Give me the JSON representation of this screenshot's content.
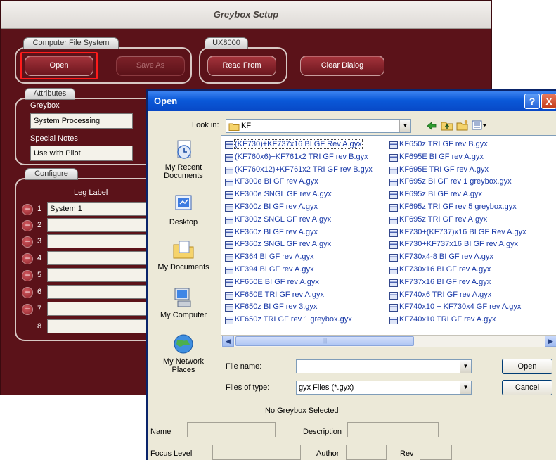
{
  "greybox": {
    "title": "Greybox Setup",
    "groups": {
      "computer_file_system": "Computer File System",
      "ux8000": "UX8000",
      "attributes": "Attributes",
      "configure": "Configure"
    },
    "buttons": {
      "open": "Open",
      "save_as": "Save As",
      "read_from": "Read From",
      "clear_dialog": "Clear Dialog"
    },
    "attributes": {
      "greybox_label": "Greybox",
      "greybox_value": "System Processing",
      "special_notes_label": "Special Notes",
      "special_notes_value": "Use with Pilot"
    },
    "configure": {
      "leg_label_header": "Leg Label",
      "rows": [
        {
          "num": "1",
          "value": "System 1"
        },
        {
          "num": "2",
          "value": ""
        },
        {
          "num": "3",
          "value": ""
        },
        {
          "num": "4",
          "value": ""
        },
        {
          "num": "5",
          "value": ""
        },
        {
          "num": "6",
          "value": ""
        },
        {
          "num": "7",
          "value": ""
        },
        {
          "num": "8",
          "value": ""
        }
      ]
    }
  },
  "open_dialog": {
    "title": "Open",
    "help_glyph": "?",
    "close_glyph": "X",
    "look_in_label": "Look in:",
    "look_in_value": "KF",
    "places": {
      "recent": "My Recent Documents",
      "desktop": "Desktop",
      "documents": "My Documents",
      "computer": "My Computer",
      "network": "My Network Places"
    },
    "files_col1": [
      "(KF730)+KF737x16 BI GF Rev A.gyx",
      "(KF760x6)+KF761x2 TRI GF rev B.gyx",
      "(KF760x12)+KF761x2 TRI GF rev B.gyx",
      "KF300e BI GF rev A.gyx",
      "KF300e SNGL GF rev A.gyx",
      "KF300z BI GF rev A.gyx",
      "KF300z SNGL GF rev A.gyx",
      "KF360z BI GF rev A.gyx",
      "KF360z SNGL GF rev A.gyx",
      "KF364 BI GF rev A.gyx",
      "KF394 BI GF rev A.gyx",
      "KF650E BI GF rev A.gyx",
      "KF650E TRI GF rev A.gyx",
      "KF650z BI GF rev 3.gyx",
      "KF650z TRI GF rev 1 greybox.gyx"
    ],
    "files_col2": [
      "KF650z TRI GF rev B.gyx",
      "KF695E BI GF rev A.gyx",
      "KF695E TRI GF rev A.gyx",
      "KF695z BI GF rev 1 greybox.gyx",
      "KF695z BI GF rev A.gyx",
      "KF695z TRI GF rev 5 greybox.gyx",
      "KF695z TRI GF rev A.gyx",
      "KF730+(KF737)x16 BI GF Rev A.gyx",
      "KF730+KF737x16 BI GF rev A.gyx",
      "KF730x4-8 BI GF rev A.gyx",
      "KF730x16 BI GF rev A.gyx",
      "KF737x16 BI GF rev A.gyx",
      "KF740x6 TRI GF rev A.gyx",
      "KF740x10 + KF730x4 GF rev A.gyx",
      "KF740x10 TRI GF rev A.gyx"
    ],
    "file_name_label": "File name:",
    "file_name_value": "",
    "files_of_type_label": "Files of type:",
    "files_of_type_value": "gyx Files (*.gyx)",
    "open_button": "Open",
    "cancel_button": "Cancel",
    "status": "No Greybox Selected",
    "name_label": "Name",
    "description_label": "Description",
    "focus_level_label": "Focus Level",
    "author_label": "Author",
    "rev_label": "Rev"
  }
}
